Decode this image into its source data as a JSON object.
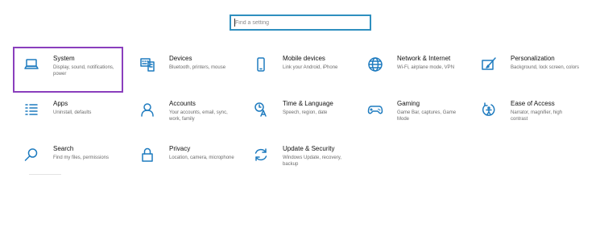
{
  "search": {
    "placeholder": "Find a setting"
  },
  "tiles": [
    {
      "title": "System",
      "desc": "Display, sound, notifications, power",
      "icon": "laptop-icon"
    },
    {
      "title": "Devices",
      "desc": "Bluetooth, printers, mouse",
      "icon": "keyboard-icon"
    },
    {
      "title": "Mobile devices",
      "desc": "Link your Android, iPhone",
      "icon": "phone-icon"
    },
    {
      "title": "Network & Internet",
      "desc": "Wi-Fi, airplane mode, VPN",
      "icon": "globe-icon"
    },
    {
      "title": "Personalization",
      "desc": "Background, lock screen, colors",
      "icon": "paintbrush-icon"
    },
    {
      "title": "Apps",
      "desc": "Uninstall, defaults",
      "icon": "apps-list-icon"
    },
    {
      "title": "Accounts",
      "desc": "Your accounts, email, sync, work, family",
      "icon": "person-icon"
    },
    {
      "title": "Time & Language",
      "desc": "Speech, region, date",
      "icon": "time-language-icon"
    },
    {
      "title": "Gaming",
      "desc": "Game Bar, captures, Game Mode",
      "icon": "gamepad-icon"
    },
    {
      "title": "Ease of Access",
      "desc": "Narrator, magnifier, high contrast",
      "icon": "ease-of-access-icon"
    },
    {
      "title": "Search",
      "desc": "Find my files, permissions",
      "icon": "search-icon"
    },
    {
      "title": "Privacy",
      "desc": "Location, camera, microphone",
      "icon": "lock-icon"
    },
    {
      "title": "Update & Security",
      "desc": "Windows Update, recovery, backup",
      "icon": "update-icon"
    }
  ],
  "colors": {
    "icon": "#1e7bbf",
    "search_border": "#2f8fbf",
    "highlight": "#8a3fbd"
  }
}
